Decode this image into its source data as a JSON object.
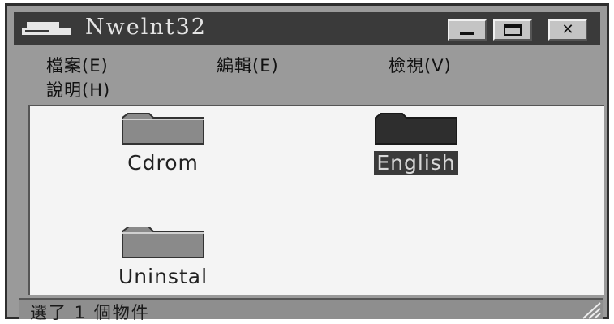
{
  "window": {
    "title": "Nwelnt32",
    "controls": {
      "minimize": "minimize",
      "maximize": "maximize",
      "close": "✕"
    }
  },
  "menu": {
    "file": "檔案(E)",
    "edit": "編輯(E)",
    "view": "檢視(V)",
    "help": "說明(H)"
  },
  "items": [
    {
      "label": "Cdrom",
      "icon": "folder-icon",
      "selected": false
    },
    {
      "label": "English",
      "icon": "folder-icon",
      "selected": true
    },
    {
      "label": "Uninstal",
      "icon": "folder-icon",
      "selected": false
    }
  ],
  "status": {
    "text": "選了 1 個物件"
  },
  "colors": {
    "titlebar": "#3a3a3a",
    "selection": "#3a3a3a",
    "window_bg": "#9a9a9a"
  }
}
